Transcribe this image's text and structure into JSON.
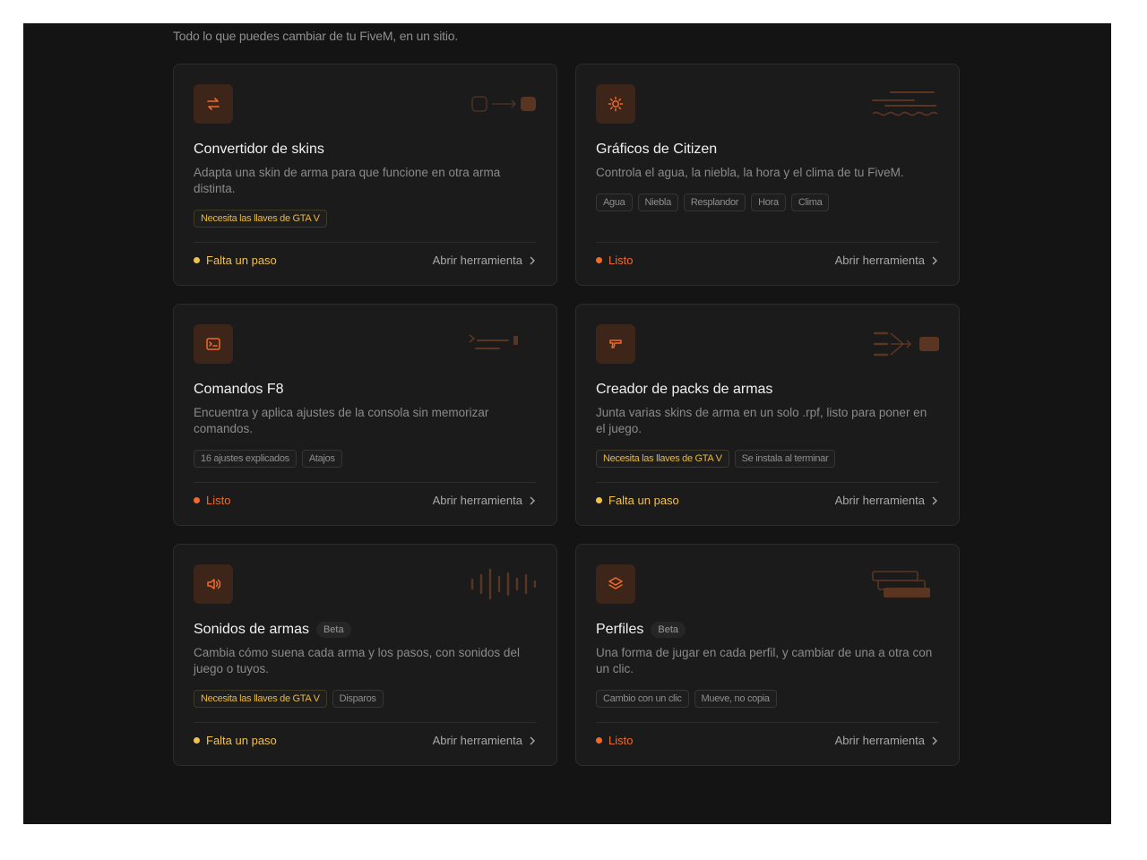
{
  "header": {
    "subtitle": "Todo lo que puedes cambiar de tu FiveM, en un sitio."
  },
  "colors": {
    "accent": "#f06a2a",
    "pending": "#f2c14a",
    "icon_bg": "#3d2519",
    "card_bg": "#1b1b1b"
  },
  "open_label": "Abrir herramienta",
  "cards": [
    {
      "icon": "swap-arrows-icon",
      "title": "Convertidor de skins",
      "desc": "Adapta una skin de arma para que funcione en otra arma distinta.",
      "tags": [
        "Necesita las llaves de GTA V"
      ],
      "status": "Falta un paso"
    },
    {
      "icon": "sun-icon",
      "title": "Gráficos de Citizen",
      "desc": "Controla el agua, la niebla, la hora y el clima de tu FiveM.",
      "tags": [
        "Agua",
        "Niebla",
        "Resplandor",
        "Hora",
        "Clima"
      ],
      "status": "Listo"
    },
    {
      "icon": "terminal-icon",
      "title": "Comandos F8",
      "desc": "Encuentra y aplica ajustes de la consola sin memorizar comandos.",
      "tags": [
        "16 ajustes explicados",
        "Atajos"
      ],
      "status": "Listo"
    },
    {
      "icon": "pistol-icon",
      "title": "Creador de packs de armas",
      "desc": "Junta varias skins de arma en un solo .rpf, listo para poner en el juego.",
      "tags": [
        "Necesita las llaves de GTA V",
        "Se instala al terminar"
      ],
      "status": "Falta un paso"
    },
    {
      "icon": "speaker-icon",
      "title": "Sonidos de armas",
      "badge": "Beta",
      "desc": "Cambia cómo suena cada arma y los pasos, con sonidos del juego o tuyos.",
      "tags": [
        "Necesita las llaves de GTA V",
        "Disparos"
      ],
      "status": "Falta un paso"
    },
    {
      "icon": "layers-icon",
      "title": "Perfiles",
      "badge": "Beta",
      "desc": "Una forma de jugar en cada perfil, y cambiar de una a otra con un clic.",
      "tags": [
        "Cambio con un clic",
        "Mueve, no copia"
      ],
      "status": "Listo"
    }
  ]
}
